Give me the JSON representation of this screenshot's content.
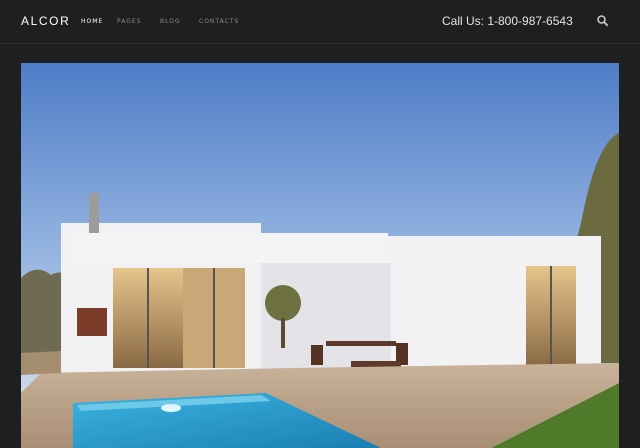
{
  "header": {
    "logo": "ALCOR",
    "nav": [
      {
        "label": "HOME",
        "active": true
      },
      {
        "label": "PAGES",
        "active": false
      },
      {
        "label": "BLOG",
        "active": false
      },
      {
        "label": "CONTACTS",
        "active": false
      }
    ],
    "phone": "Call Us: 1-800-987-6543",
    "search_icon": "search-icon"
  },
  "hero": {
    "image": "modern-house-with-pool-photo"
  },
  "colors": {
    "background": "#1e1f21",
    "nav_inactive": "#8a8c90",
    "nav_active": "#ffffff"
  }
}
